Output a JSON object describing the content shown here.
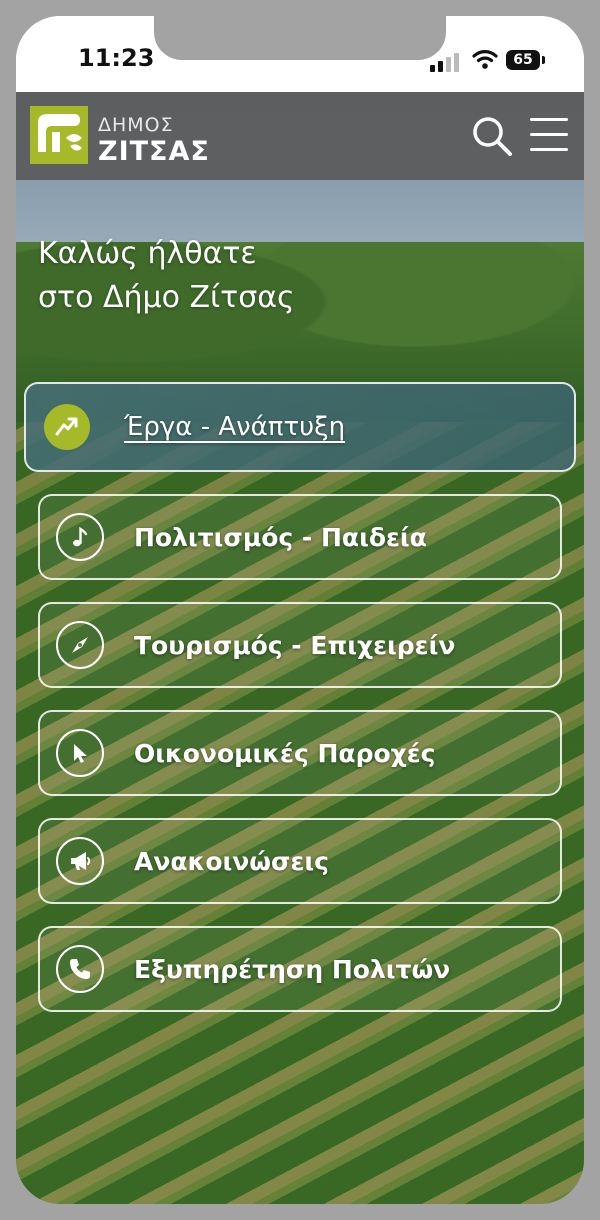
{
  "status_bar": {
    "time": "11:23",
    "battery": "65",
    "icons": [
      "signal-icon",
      "wifi-icon",
      "battery-icon"
    ]
  },
  "header": {
    "logo_top": "ΔΗΜΟΣ",
    "logo_bottom": "ΖΙΤΣΑΣ",
    "brand_color": "#a6b928",
    "search_icon": "search-icon",
    "menu_icon": "hamburger-menu-icon"
  },
  "welcome": {
    "line1": "Καλώς ήλθατε",
    "line2": "στο Δήμο Ζίτσας"
  },
  "nav": {
    "items": [
      {
        "label": "Έργα - Ανάπτυξη",
        "icon": "trend-up-icon",
        "active": true
      },
      {
        "label": "Πολιτισμός - Παιδεία",
        "icon": "music-note-icon",
        "active": false
      },
      {
        "label": "Τουρισμός - Επιχειρείν",
        "icon": "compass-icon",
        "active": false
      },
      {
        "label": "Οικονομικές Παροχές",
        "icon": "cursor-icon",
        "active": false
      },
      {
        "label": "Ανακοινώσεις",
        "icon": "megaphone-icon",
        "active": false
      },
      {
        "label": "Εξυπηρέτηση Πολιτών",
        "icon": "phone-icon",
        "active": false
      }
    ]
  }
}
